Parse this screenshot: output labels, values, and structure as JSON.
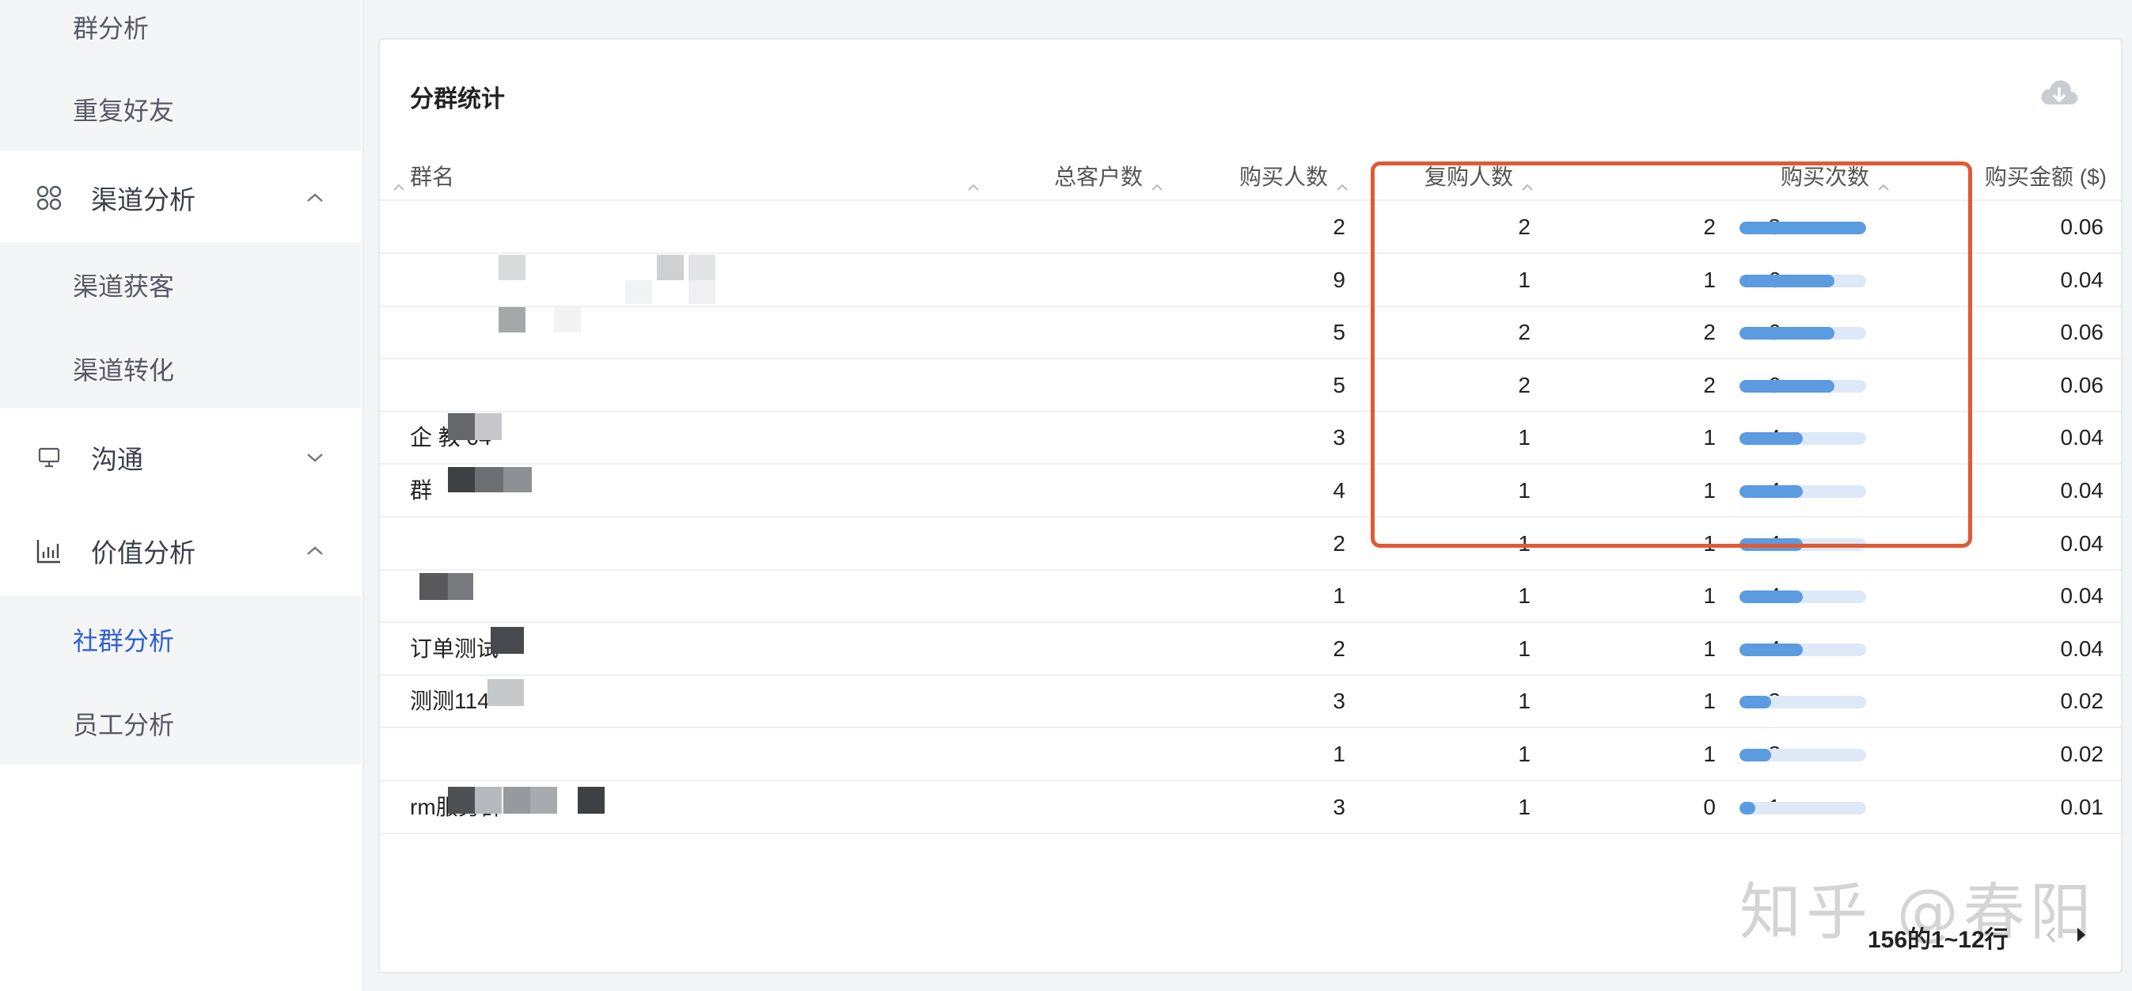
{
  "sidebar": {
    "items_top": [
      {
        "label": "群分析"
      },
      {
        "label": "重复好友"
      }
    ],
    "groups": [
      {
        "label": "渠道分析",
        "icon": "grid-icon",
        "expanded": true,
        "children": [
          {
            "label": "渠道获客"
          },
          {
            "label": "渠道转化"
          }
        ]
      },
      {
        "label": "沟通",
        "icon": "monitor-icon",
        "expanded": false,
        "children": []
      },
      {
        "label": "价值分析",
        "icon": "bar-chart-icon",
        "expanded": true,
        "children": [
          {
            "label": "社群分析",
            "active": true
          },
          {
            "label": "员工分析"
          }
        ]
      }
    ]
  },
  "card": {
    "title": "分群统计",
    "download_icon": "cloud-download-icon"
  },
  "table": {
    "columns": {
      "group_name": "群名",
      "total_customers": "总客户数",
      "buyers": "购买人数",
      "repeat_buyers": "复购人数",
      "purchases": "购买次数",
      "amount": "购买金额 ($)"
    },
    "rows": [
      {
        "name": "",
        "total": "2",
        "buyers": "2",
        "repeat": "2",
        "purchases": "8",
        "purchase_ratio": 1.0,
        "amount": "0.06"
      },
      {
        "name": "",
        "total": "9",
        "buyers": "1",
        "repeat": "1",
        "purchases": "6",
        "purchase_ratio": 0.75,
        "amount": "0.04"
      },
      {
        "name": "",
        "total": "5",
        "buyers": "2",
        "repeat": "2",
        "purchases": "6",
        "purchase_ratio": 0.75,
        "amount": "0.06"
      },
      {
        "name": "",
        "total": "5",
        "buyers": "2",
        "repeat": "2",
        "purchases": "6",
        "purchase_ratio": 0.75,
        "amount": "0.06"
      },
      {
        "name": "企     教    04",
        "total": "3",
        "buyers": "1",
        "repeat": "1",
        "purchases": "4",
        "purchase_ratio": 0.5,
        "amount": "0.04"
      },
      {
        "name": "       群",
        "total": "4",
        "buyers": "1",
        "repeat": "1",
        "purchases": "4",
        "purchase_ratio": 0.5,
        "amount": "0.04"
      },
      {
        "name": "",
        "total": "2",
        "buyers": "1",
        "repeat": "1",
        "purchases": "4",
        "purchase_ratio": 0.5,
        "amount": "0.04"
      },
      {
        "name": "",
        "total": "1",
        "buyers": "1",
        "repeat": "1",
        "purchases": "4",
        "purchase_ratio": 0.5,
        "amount": "0.04"
      },
      {
        "name": "订单测试",
        "total": "2",
        "buyers": "1",
        "repeat": "1",
        "purchases": "4",
        "purchase_ratio": 0.5,
        "amount": "0.04"
      },
      {
        "name": "测测114",
        "total": "3",
        "buyers": "1",
        "repeat": "1",
        "purchases": "2",
        "purchase_ratio": 0.25,
        "amount": "0.02"
      },
      {
        "name": "",
        "total": "1",
        "buyers": "1",
        "repeat": "1",
        "purchases": "2",
        "purchase_ratio": 0.25,
        "amount": "0.02"
      },
      {
        "name": "                rm服务群",
        "total": "3",
        "buyers": "1",
        "repeat": "0",
        "purchases": "1",
        "purchase_ratio": 0.125,
        "amount": "0.01"
      }
    ]
  },
  "pagination": {
    "summary": "156的1~12行",
    "prev_icon": "chevron-left-icon",
    "next_icon": "chevron-right-icon"
  },
  "watermark": "知乎 @春阳",
  "colors": {
    "accent": "#2f5fd6",
    "bar": "#5b9be0",
    "bar_track": "#dde9f7",
    "highlight": "#e05a33"
  }
}
